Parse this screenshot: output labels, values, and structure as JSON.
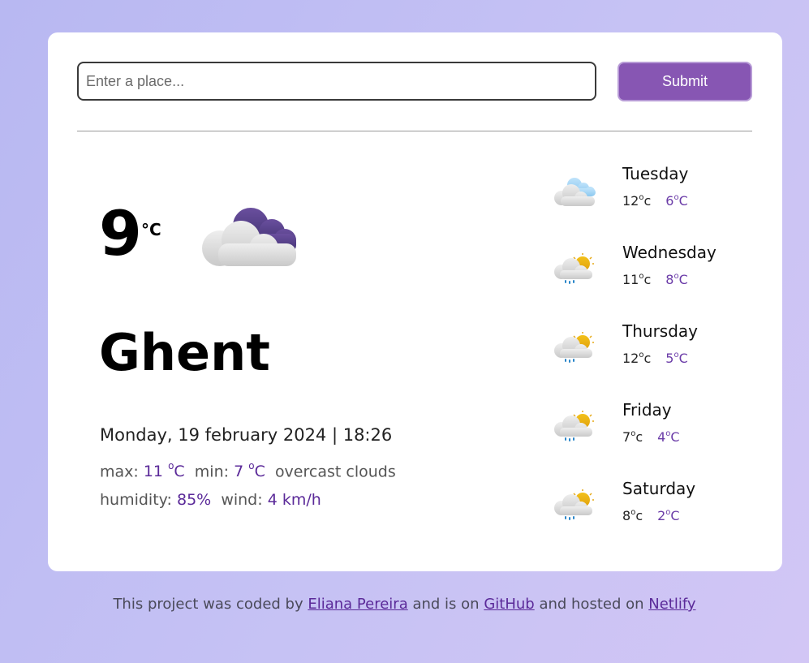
{
  "search": {
    "placeholder": "Enter a place...",
    "submit_label": "Submit"
  },
  "current": {
    "temperature": "9",
    "unit": "°C",
    "icon": "cloud-icon",
    "city": "Ghent",
    "datetime": "Monday, 19 february 2024 | 18:26",
    "max_label": "max:",
    "max_value": "11",
    "min_label": "min:",
    "min_value": "7",
    "deg_sup": "o",
    "deg_c": "C",
    "description": "overcast clouds",
    "humidity_label": "humidity:",
    "humidity_value": "85%",
    "wind_label": "wind:",
    "wind_value": "4 km/h"
  },
  "forecast": [
    {
      "day": "Tuesday",
      "max": "12",
      "min": "6",
      "icon": "cloudy-icon"
    },
    {
      "day": "Wednesday",
      "max": "11",
      "min": "8",
      "icon": "sun-rain-icon"
    },
    {
      "day": "Thursday",
      "max": "12",
      "min": "5",
      "icon": "sun-rain-icon"
    },
    {
      "day": "Friday",
      "max": "7",
      "min": "4",
      "icon": "sun-rain-icon"
    },
    {
      "day": "Saturday",
      "max": "8",
      "min": "2",
      "icon": "sun-rain-icon"
    }
  ],
  "forecast_unit": {
    "sup": "o",
    "max_c": "c",
    "min_c": "C"
  },
  "footer": {
    "text1": "This project was coded by",
    "author": "Eliana Pereira",
    "text2": "and is on",
    "github": "GitHub",
    "text3": "and hosted on",
    "netlify": "Netlify"
  },
  "colors": {
    "accent": "#8756b3",
    "highlight": "#5b2a99"
  }
}
